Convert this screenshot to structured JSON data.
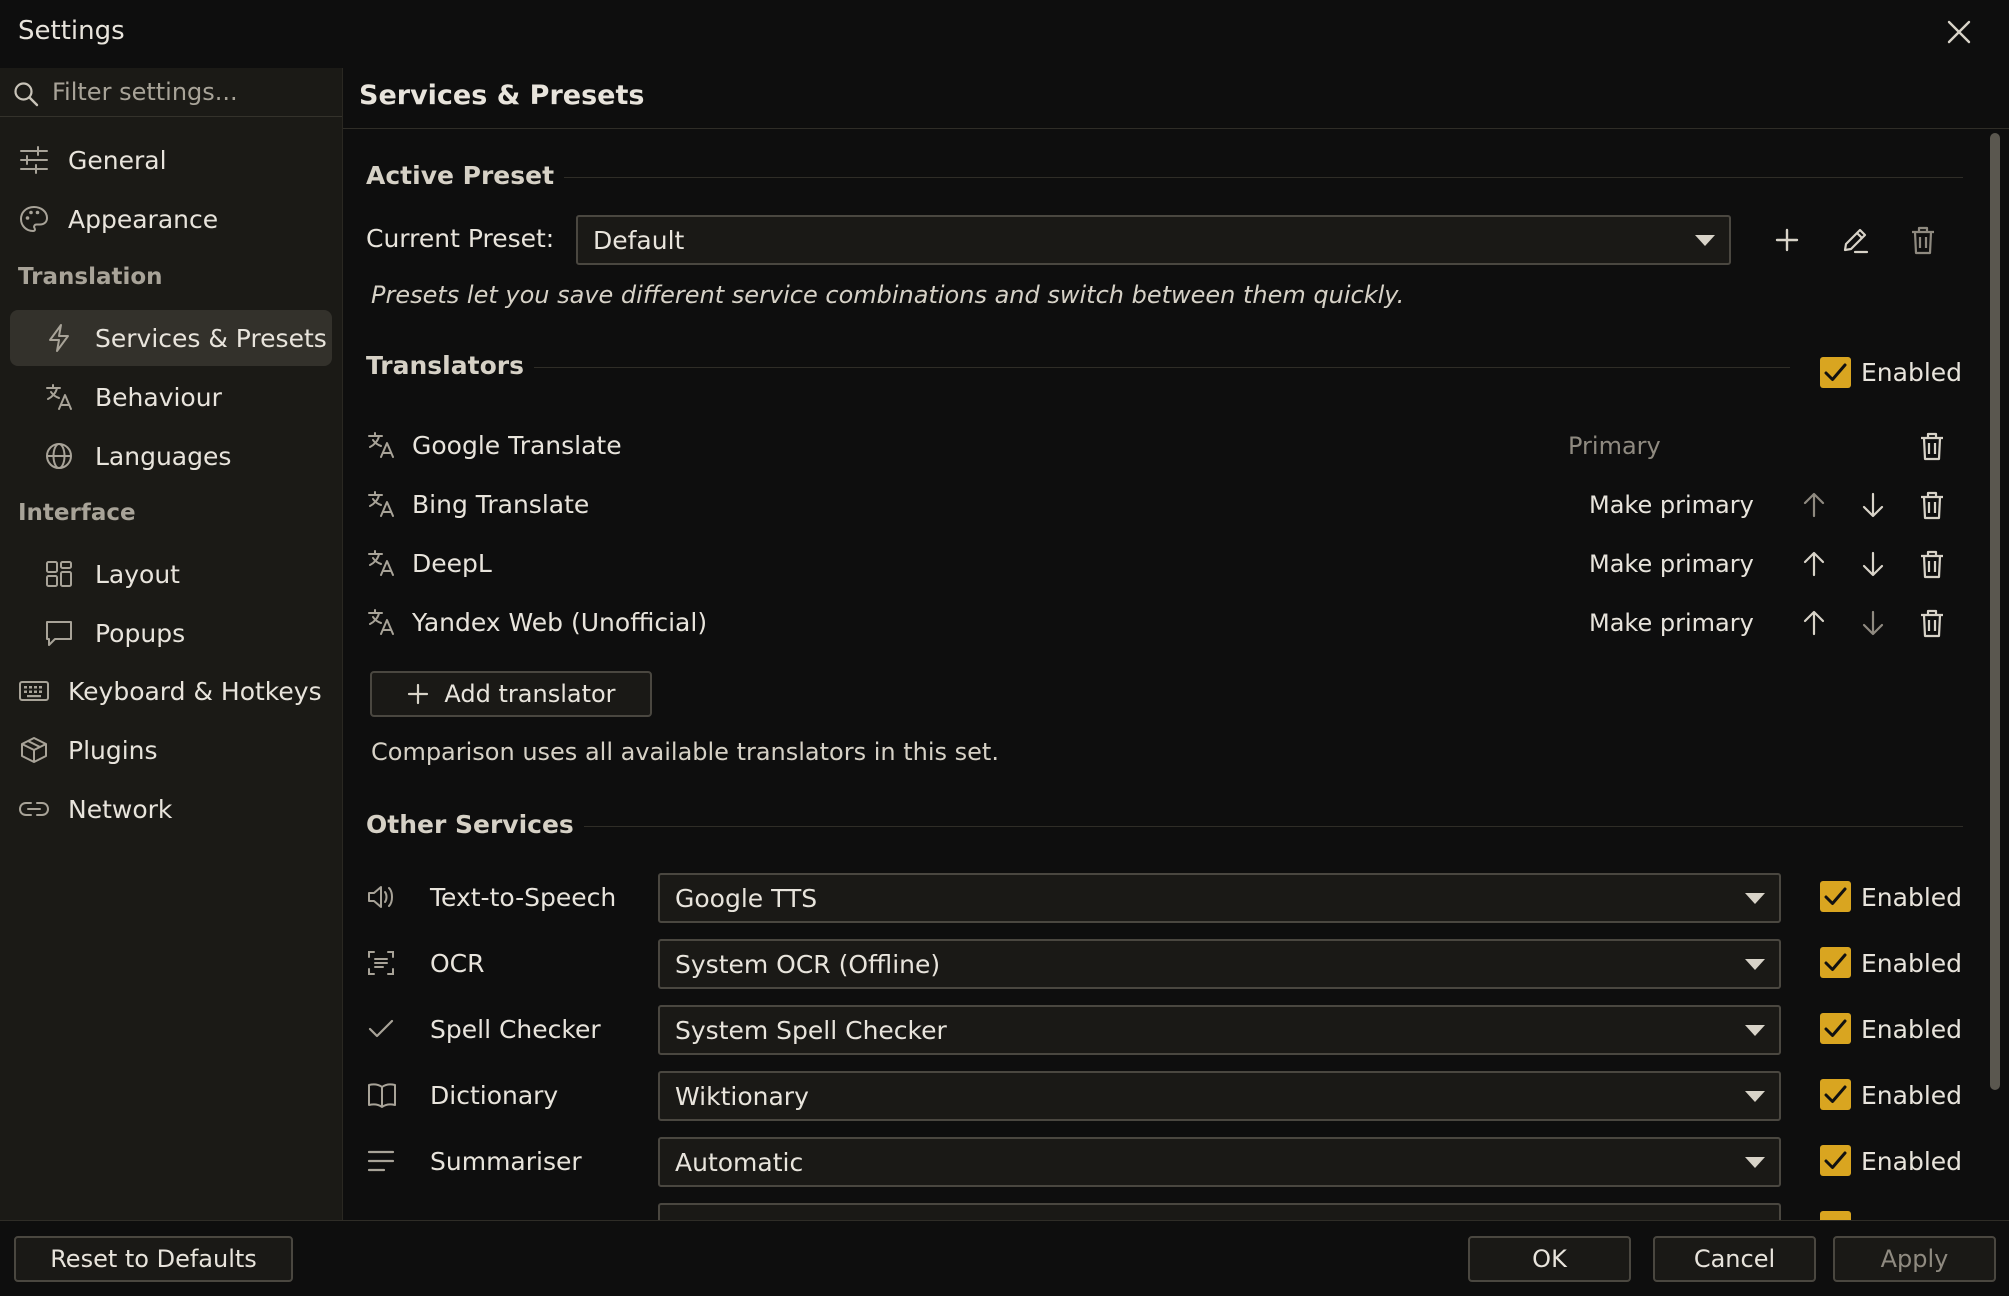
{
  "window": {
    "title": "Settings"
  },
  "search": {
    "placeholder": "Filter settings..."
  },
  "sidebar": {
    "items": [
      {
        "label": "General",
        "icon": "sliders-icon"
      },
      {
        "label": "Appearance",
        "icon": "palette-icon"
      }
    ],
    "groups": [
      {
        "label": "Translation",
        "items": [
          {
            "label": "Services & Presets",
            "icon": "lightning-icon",
            "active": true
          },
          {
            "label": "Behaviour",
            "icon": "translate-icon"
          },
          {
            "label": "Languages",
            "icon": "globe-icon"
          }
        ]
      },
      {
        "label": "Interface",
        "items": [
          {
            "label": "Layout",
            "icon": "layout-icon"
          },
          {
            "label": "Popups",
            "icon": "chat-bubble-icon"
          }
        ]
      }
    ],
    "bottom_items": [
      {
        "label": "Keyboard & Hotkeys",
        "icon": "keyboard-icon"
      },
      {
        "label": "Plugins",
        "icon": "package-icon"
      },
      {
        "label": "Network",
        "icon": "link-icon"
      }
    ]
  },
  "main": {
    "title": "Services & Presets",
    "active_preset": {
      "section_title": "Active Preset",
      "current_label": "Current Preset:",
      "current_value": "Default",
      "hint": "Presets let you save different service combinations and switch between them quickly."
    },
    "translators": {
      "section_title": "Translators",
      "enabled_label": "Enabled",
      "enabled": true,
      "items": [
        {
          "name": "Google Translate",
          "status": "Primary"
        },
        {
          "name": "Bing Translate",
          "action": "Make primary"
        },
        {
          "name": "DeepL",
          "action": "Make primary"
        },
        {
          "name": "Yandex Web (Unofficial)",
          "action": "Make primary"
        }
      ],
      "add_button": "Add translator",
      "note": "Comparison uses all available translators in this set."
    },
    "other_services": {
      "section_title": "Other Services",
      "items": [
        {
          "label": "Text-to-Speech",
          "icon": "speaker-icon",
          "value": "Google TTS",
          "enabled_label": "Enabled",
          "enabled": true
        },
        {
          "label": "OCR",
          "icon": "scan-text-icon",
          "value": "System OCR (Offline)",
          "enabled_label": "Enabled",
          "enabled": true
        },
        {
          "label": "Spell Checker",
          "icon": "checkmark-icon",
          "value": "System Spell Checker",
          "enabled_label": "Enabled",
          "enabled": true
        },
        {
          "label": "Dictionary",
          "icon": "book-icon",
          "value": "Wiktionary",
          "enabled_label": "Enabled",
          "enabled": true
        },
        {
          "label": "Summariser",
          "icon": "lines-icon",
          "value": "Automatic",
          "enabled_label": "Enabled",
          "enabled": true
        }
      ]
    }
  },
  "footer": {
    "reset_label": "Reset to Defaults",
    "ok_label": "OK",
    "cancel_label": "Cancel",
    "apply_label": "Apply"
  },
  "colors": {
    "accent": "#d9a520",
    "background": "#0e0e0e",
    "sidebar": "#1b1a16",
    "active_item": "#33312b"
  }
}
